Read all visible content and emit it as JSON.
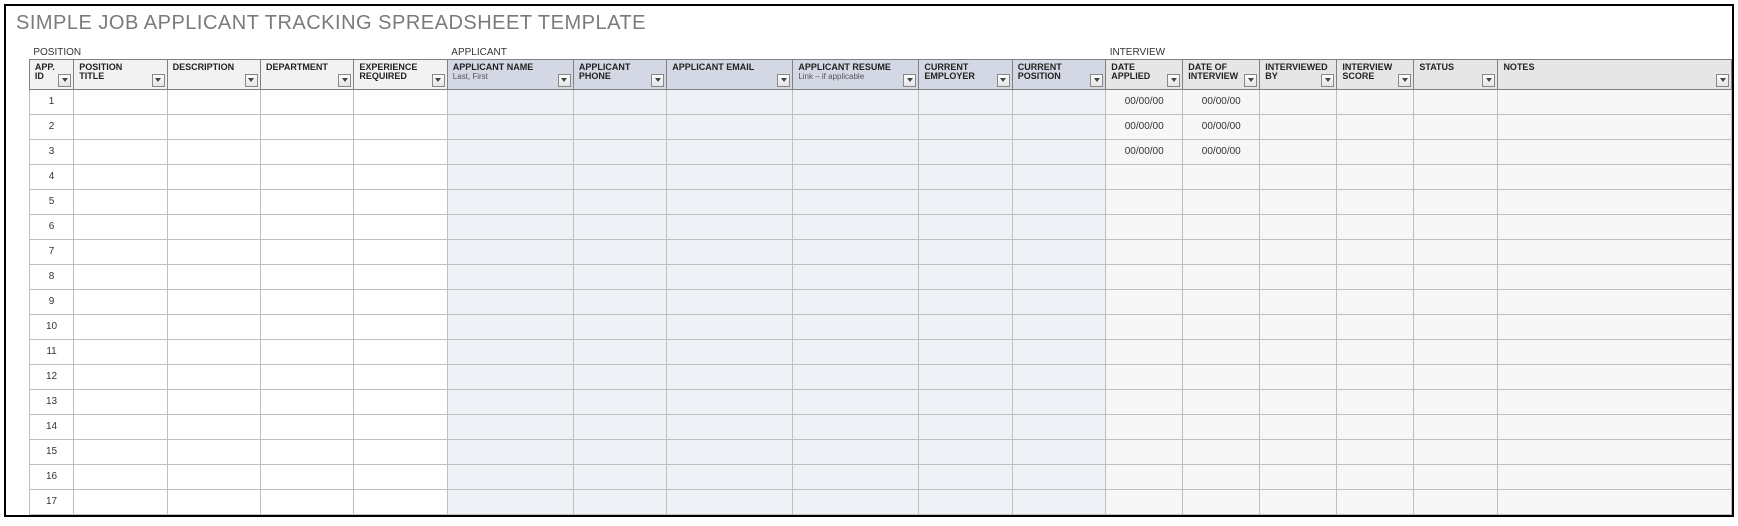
{
  "title": "SIMPLE JOB APPLICANT TRACKING SPREADSHEET TEMPLATE",
  "sections": {
    "position": "POSITION",
    "applicant": "APPLICANT",
    "interview": "INTERVIEW"
  },
  "headers": {
    "id": {
      "label": "APP. ID",
      "sub": ""
    },
    "pt": {
      "label": "POSITION TITLE",
      "sub": ""
    },
    "de": {
      "label": "DESCRIPTION",
      "sub": ""
    },
    "dp": {
      "label": "DEPARTMENT",
      "sub": ""
    },
    "ex": {
      "label": "EXPERIENCE REQUIRED",
      "sub": ""
    },
    "an": {
      "label": "APPLICANT NAME",
      "sub": "Last, First"
    },
    "ap": {
      "label": "APPLICANT PHONE",
      "sub": ""
    },
    "ae": {
      "label": "APPLICANT EMAIL",
      "sub": ""
    },
    "ar": {
      "label": "APPLICANT RESUME",
      "sub": "Link – if applicable"
    },
    "ce": {
      "label": "CURRENT EMPLOYER",
      "sub": ""
    },
    "cp": {
      "label": "CURRENT POSITION",
      "sub": ""
    },
    "da": {
      "label": "DATE APPLIED",
      "sub": ""
    },
    "di": {
      "label": "DATE OF INTERVIEW",
      "sub": ""
    },
    "ib": {
      "label": "INTERVIEWED BY",
      "sub": ""
    },
    "is": {
      "label": "INTERVIEW SCORE",
      "sub": ""
    },
    "st": {
      "label": "STATUS",
      "sub": ""
    },
    "no": {
      "label": "NOTES",
      "sub": ""
    }
  },
  "rows": [
    {
      "id": "1",
      "da": "00/00/00",
      "di": "00/00/00"
    },
    {
      "id": "2",
      "da": "00/00/00",
      "di": "00/00/00"
    },
    {
      "id": "3",
      "da": "00/00/00",
      "di": "00/00/00"
    },
    {
      "id": "4",
      "da": "",
      "di": ""
    },
    {
      "id": "5",
      "da": "",
      "di": ""
    },
    {
      "id": "6",
      "da": "",
      "di": ""
    },
    {
      "id": "7",
      "da": "",
      "di": ""
    },
    {
      "id": "8",
      "da": "",
      "di": ""
    },
    {
      "id": "9",
      "da": "",
      "di": ""
    },
    {
      "id": "10",
      "da": "",
      "di": ""
    },
    {
      "id": "11",
      "da": "",
      "di": ""
    },
    {
      "id": "12",
      "da": "",
      "di": ""
    },
    {
      "id": "13",
      "da": "",
      "di": ""
    },
    {
      "id": "14",
      "da": "",
      "di": ""
    },
    {
      "id": "15",
      "da": "",
      "di": ""
    },
    {
      "id": "16",
      "da": "",
      "di": ""
    },
    {
      "id": "17",
      "da": "",
      "di": ""
    }
  ]
}
